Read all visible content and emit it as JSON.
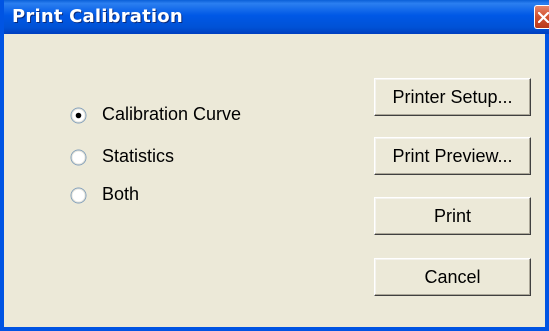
{
  "window": {
    "title": "Print Calibration"
  },
  "options": [
    {
      "label": "Calibration Curve",
      "selected": true
    },
    {
      "label": "Statistics",
      "selected": false
    },
    {
      "label": "Both",
      "selected": false
    }
  ],
  "buttons": {
    "printer_setup": "Printer Setup...",
    "print_preview": "Print Preview...",
    "print": "Print",
    "cancel": "Cancel"
  },
  "colors": {
    "titlebar": "#0058e6",
    "dialog_bg": "#ece9d8",
    "close_button": "#d0502e"
  },
  "icons": {
    "close": "close-icon",
    "radio": "radio-button"
  }
}
